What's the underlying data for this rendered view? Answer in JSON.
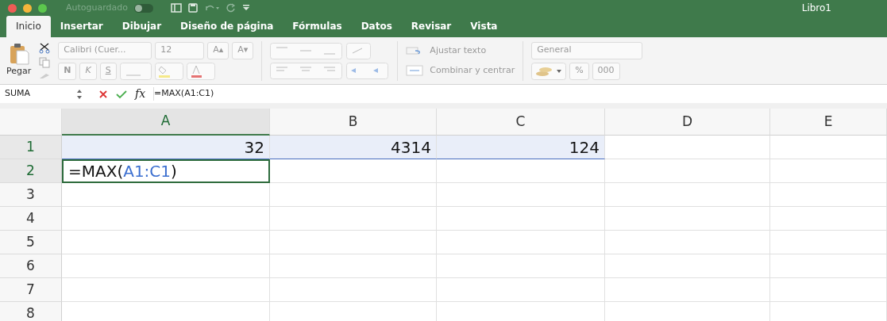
{
  "window": {
    "title": "Libro1",
    "autosave_label": "Autoguardado",
    "autosave_on": false
  },
  "tabs": [
    {
      "label": "Inicio",
      "selected": true
    },
    {
      "label": "Insertar",
      "selected": false
    },
    {
      "label": "Dibujar",
      "selected": false
    },
    {
      "label": "Diseño de página",
      "selected": false
    },
    {
      "label": "Fórmulas",
      "selected": false
    },
    {
      "label": "Datos",
      "selected": false
    },
    {
      "label": "Revisar",
      "selected": false
    },
    {
      "label": "Vista",
      "selected": false
    }
  ],
  "ribbon": {
    "paste_label": "Pegar",
    "font_name": "Calibri (Cuer...",
    "font_size": "12",
    "grow_font": "A▴",
    "shrink_font": "A▾",
    "bold_key": "N",
    "italic_key": "K",
    "underline_key": "S",
    "wrap_text": "Ajustar texto",
    "merge_center": "Combinar y centrar",
    "number_format": "General",
    "percent": "%",
    "thousands": "000"
  },
  "formula_bar": {
    "name_box": "SUMA",
    "fx": "fx",
    "formula": "=MAX(A1:C1)"
  },
  "sheet": {
    "columns": [
      {
        "label": "A",
        "selected": true
      },
      {
        "label": "B",
        "selected": false
      },
      {
        "label": "C",
        "selected": false
      },
      {
        "label": "D",
        "selected": false
      },
      {
        "label": "E",
        "selected": false
      }
    ],
    "rows": [
      {
        "label": "1",
        "selected": true,
        "cells": [
          {
            "text": "32",
            "in_reference": true,
            "active": false
          },
          {
            "text": "4314",
            "in_reference": true,
            "active": false
          },
          {
            "text": "124",
            "in_reference": true,
            "active": false
          }
        ]
      },
      {
        "label": "2",
        "selected": true,
        "cells": [
          {
            "parts": [
              {
                "text": "=MAX(",
                "ref": false
              },
              {
                "text": "A1:C1",
                "ref": true
              },
              {
                "text": ")",
                "ref": false
              }
            ],
            "in_reference": false,
            "active": true
          }
        ]
      },
      {
        "label": "3",
        "selected": false
      },
      {
        "label": "4",
        "selected": false
      },
      {
        "label": "5",
        "selected": false
      },
      {
        "label": "6",
        "selected": false
      },
      {
        "label": "7",
        "selected": false
      },
      {
        "label": "8",
        "selected": false
      }
    ]
  }
}
